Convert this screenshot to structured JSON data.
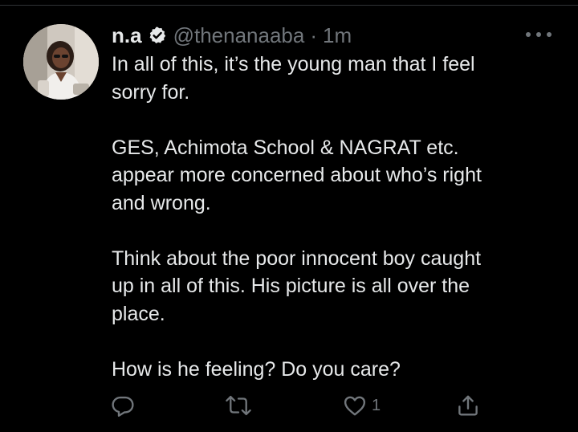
{
  "tweet": {
    "display_name": "n.a",
    "handle": "@thenanaaba",
    "separator": "·",
    "time": "1m",
    "paragraphs": [
      "In all of this, it’s the young man that I feel\nsorry for.",
      "GES, Achimota School & NAGRAT etc.\nappear more concerned about who’s right\nand wrong.",
      "Think about the poor innocent boy caught\nup in all of this. His picture is all over the\nplace.",
      "How is he feeling? Do you care?"
    ],
    "like_count": "1"
  },
  "icons": {
    "verified": "verified-badge-icon",
    "more": "more-options-icon",
    "reply": "reply-icon",
    "retweet": "retweet-icon",
    "like": "like-heart-icon",
    "share": "share-icon"
  },
  "colors": {
    "background": "#000000",
    "text_primary": "#e7e9ea",
    "text_secondary": "#71767b",
    "divider": "#2f3336"
  }
}
